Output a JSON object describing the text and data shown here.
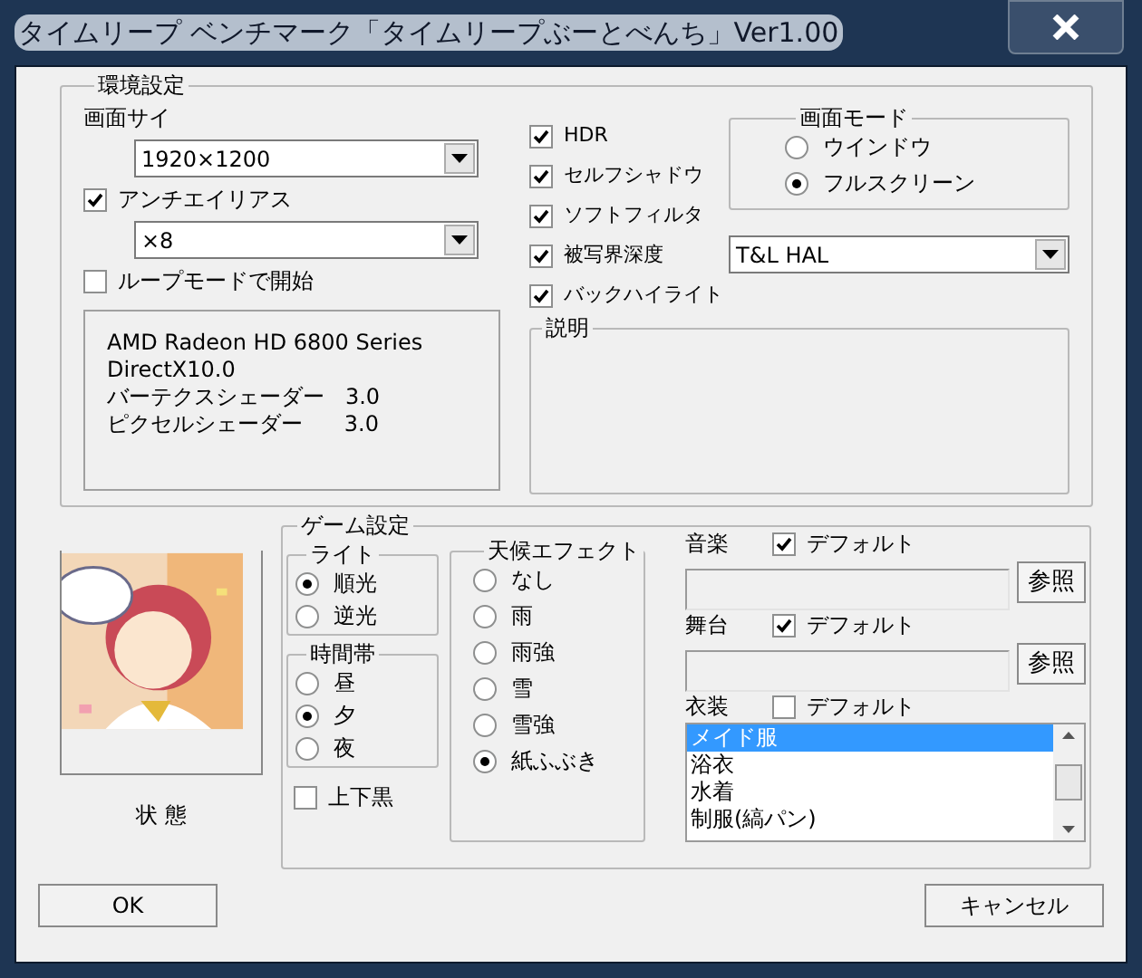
{
  "window": {
    "title": "タイムリープ ベンチマーク「タイムリープぶーとべんち」Ver1.00"
  },
  "env": {
    "title": "環境設定",
    "resolution": {
      "label": "画面サイ",
      "value": "1920×1200"
    },
    "antialias": {
      "label": "アンチエイリアス",
      "checked": true,
      "value": "×8"
    },
    "loop_mode": {
      "label": "ループモードで開始",
      "checked": false
    },
    "gpu_info": [
      "AMD Radeon HD 6800 Series",
      "DirectX10.0",
      "バーテクスシェーダー   3.0",
      "ピクセルシェーダー      3.0"
    ],
    "effects": [
      {
        "label": "HDR",
        "checked": true
      },
      {
        "label": "セルフシャドウ",
        "checked": true
      },
      {
        "label": "ソフトフィルタ",
        "checked": true
      },
      {
        "label": "被写界深度",
        "checked": true
      },
      {
        "label": "バックハイライト",
        "checked": true
      }
    ],
    "screen_mode": {
      "title": "画面モード",
      "options": [
        {
          "label": "ウインドウ",
          "selected": false
        },
        {
          "label": "フルスクリーン",
          "selected": true
        }
      ]
    },
    "renderer": {
      "value": "T&L HAL"
    },
    "description": {
      "title": "説明"
    }
  },
  "status": {
    "label": "状 態"
  },
  "game": {
    "title": "ゲーム設定",
    "light": {
      "title": "ライト",
      "options": [
        {
          "label": "順光",
          "selected": true
        },
        {
          "label": "逆光",
          "selected": false
        }
      ]
    },
    "time": {
      "title": "時間帯",
      "options": [
        {
          "label": "昼",
          "selected": false
        },
        {
          "label": "夕",
          "selected": true
        },
        {
          "label": "夜",
          "selected": false
        }
      ]
    },
    "letterbox": {
      "label": "上下黒",
      "checked": false
    },
    "weather": {
      "title": "天候エフェクト",
      "options": [
        {
          "label": "なし",
          "selected": false
        },
        {
          "label": "雨",
          "selected": false
        },
        {
          "label": "雨強",
          "selected": false
        },
        {
          "label": "雪",
          "selected": false
        },
        {
          "label": "雪強",
          "selected": false
        },
        {
          "label": "紙ふぶき",
          "selected": true
        }
      ]
    },
    "music": {
      "label": "音楽",
      "default_label": "デフォルト",
      "default_checked": true,
      "browse": "参照"
    },
    "stage": {
      "label": "舞台",
      "default_label": "デフォルト",
      "default_checked": true,
      "browse": "参照"
    },
    "costume": {
      "label": "衣装",
      "default_label": "デフォルト",
      "default_checked": false,
      "items": [
        {
          "label": "メイド服",
          "selected": true
        },
        {
          "label": "浴衣",
          "selected": false
        },
        {
          "label": "水着",
          "selected": false
        },
        {
          "label": "制服(縞パン)",
          "selected": false
        }
      ]
    }
  },
  "buttons": {
    "ok": "OK",
    "cancel": "キャンセル"
  }
}
